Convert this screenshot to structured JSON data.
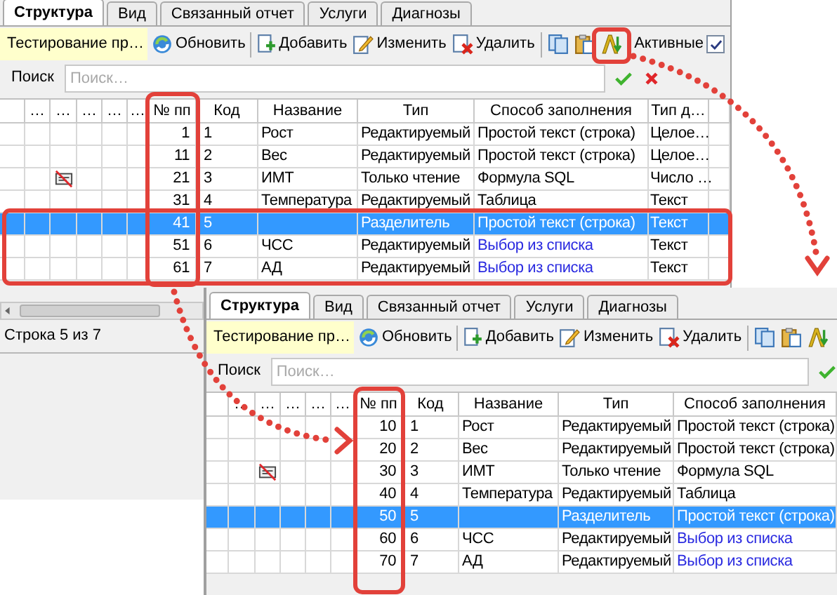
{
  "windows": [
    {
      "tabs": [
        {
          "label": "Структура",
          "selected": true
        },
        {
          "label": "Вид",
          "selected": false
        },
        {
          "label": "Связанный отчет",
          "selected": false
        },
        {
          "label": "Услуги",
          "selected": false
        },
        {
          "label": "Диагнозы",
          "selected": false
        }
      ],
      "toolbar": {
        "label": "Тестирование пр…",
        "buttons": [
          {
            "kind": "refresh",
            "label": "Обновить"
          },
          {
            "kind": "add",
            "label": "Добавить"
          },
          {
            "kind": "edit",
            "label": "Изменить"
          },
          {
            "kind": "delete",
            "label": "Удалить"
          },
          {
            "kind": "copy"
          },
          {
            "kind": "paste"
          },
          {
            "kind": "sort"
          }
        ],
        "filter": {
          "label": "Активные",
          "checked": true
        }
      },
      "search": {
        "label": "Поиск",
        "placeholder": "Поиск…",
        "actions": [
          {
            "kind": "apply"
          },
          {
            "kind": "clear"
          }
        ]
      },
      "columns": [
        "…",
        "…",
        "…",
        "…",
        "…",
        "№ пп",
        "Код",
        "Название",
        "Тип",
        "Способ заполнения",
        "Тип д…"
      ],
      "rows": [
        {
          "npp": "1",
          "code": "1",
          "name": "Рост",
          "type": "Редактируемый",
          "fill": "Простой текст (строка)",
          "fill_link": false,
          "data_type": "Целое…",
          "no_note": false,
          "selected": false
        },
        {
          "npp": "11",
          "code": "2",
          "name": "Вес",
          "type": "Редактируемый",
          "fill": "Простой текст (строка)",
          "fill_link": false,
          "data_type": "Целое…",
          "no_note": false,
          "selected": false
        },
        {
          "npp": "21",
          "code": "3",
          "name": "ИМТ",
          "type": "Только чтение",
          "fill": "Формула SQL",
          "fill_link": false,
          "data_type": "Число …",
          "no_note": true,
          "selected": false
        },
        {
          "npp": "31",
          "code": "4",
          "name": "Температура",
          "type": "Редактируемый",
          "fill": "Таблица",
          "fill_link": false,
          "data_type": "Текст",
          "no_note": false,
          "selected": false
        },
        {
          "npp": "41",
          "code": "5",
          "type": "Разделитель",
          "fill": "Простой текст (строка)",
          "fill_link": false,
          "data_type": "Текст",
          "no_note": false,
          "selected": true
        },
        {
          "npp": "51",
          "code": "6",
          "name": "ЧСС",
          "type": "Редактируемый",
          "fill": "Выбор из списка",
          "fill_link": true,
          "data_type": "Текст",
          "no_note": false,
          "selected": false
        },
        {
          "npp": "61",
          "code": "7",
          "name": "АД",
          "type": "Редактируемый",
          "fill": "Выбор из списка",
          "fill_link": true,
          "data_type": "Текст",
          "no_note": false,
          "selected": false
        }
      ],
      "status": "Строка 5 из 7"
    },
    {
      "tabs": [
        {
          "label": "Структура",
          "selected": true
        },
        {
          "label": "Вид",
          "selected": false
        },
        {
          "label": "Связанный отчет",
          "selected": false
        },
        {
          "label": "Услуги",
          "selected": false
        },
        {
          "label": "Диагнозы",
          "selected": false
        }
      ],
      "toolbar": {
        "label": "Тестирование пр…",
        "buttons": [
          {
            "kind": "refresh",
            "label": "Обновить"
          },
          {
            "kind": "add",
            "label": "Добавить"
          },
          {
            "kind": "edit",
            "label": "Изменить"
          },
          {
            "kind": "delete",
            "label": "Удалить"
          },
          {
            "kind": "copy"
          },
          {
            "kind": "paste"
          },
          {
            "kind": "sort"
          }
        ]
      },
      "search": {
        "label": "Поиск",
        "placeholder": "Поиск…",
        "actions": [
          {
            "kind": "apply"
          }
        ]
      },
      "columns": [
        "…",
        "…",
        "…",
        "…",
        "…",
        "№ пп",
        "Код",
        "Название",
        "Тип",
        "Способ заполнения"
      ],
      "rows": [
        {
          "npp": "10",
          "code": "1",
          "name": "Рост",
          "type": "Редактируемый",
          "fill": "Простой текст (строка)",
          "fill_link": false,
          "no_note": false,
          "selected": false
        },
        {
          "npp": "20",
          "code": "2",
          "name": "Вес",
          "type": "Редактируемый",
          "fill": "Простой текст (строка)",
          "fill_link": false,
          "no_note": false,
          "selected": false
        },
        {
          "npp": "30",
          "code": "3",
          "name": "ИМТ",
          "type": "Только чтение",
          "fill": "Формула SQL",
          "fill_link": false,
          "no_note": true,
          "selected": false
        },
        {
          "npp": "40",
          "code": "4",
          "name": "Температура",
          "type": "Редактируемый",
          "fill": "Таблица",
          "fill_link": false,
          "no_note": false,
          "selected": false
        },
        {
          "npp": "50",
          "code": "5",
          "type": "Разделитель",
          "fill": "Простой текст (строка)",
          "fill_link": false,
          "no_note": false,
          "selected": true
        },
        {
          "npp": "60",
          "code": "6",
          "name": "ЧСС",
          "type": "Редактируемый",
          "fill": "Выбор из списка",
          "fill_link": true,
          "no_note": false,
          "selected": false
        },
        {
          "npp": "70",
          "code": "7",
          "name": "АД",
          "type": "Редактируемый",
          "fill": "Выбор из списка",
          "fill_link": true,
          "no_note": false,
          "selected": false
        }
      ]
    }
  ]
}
